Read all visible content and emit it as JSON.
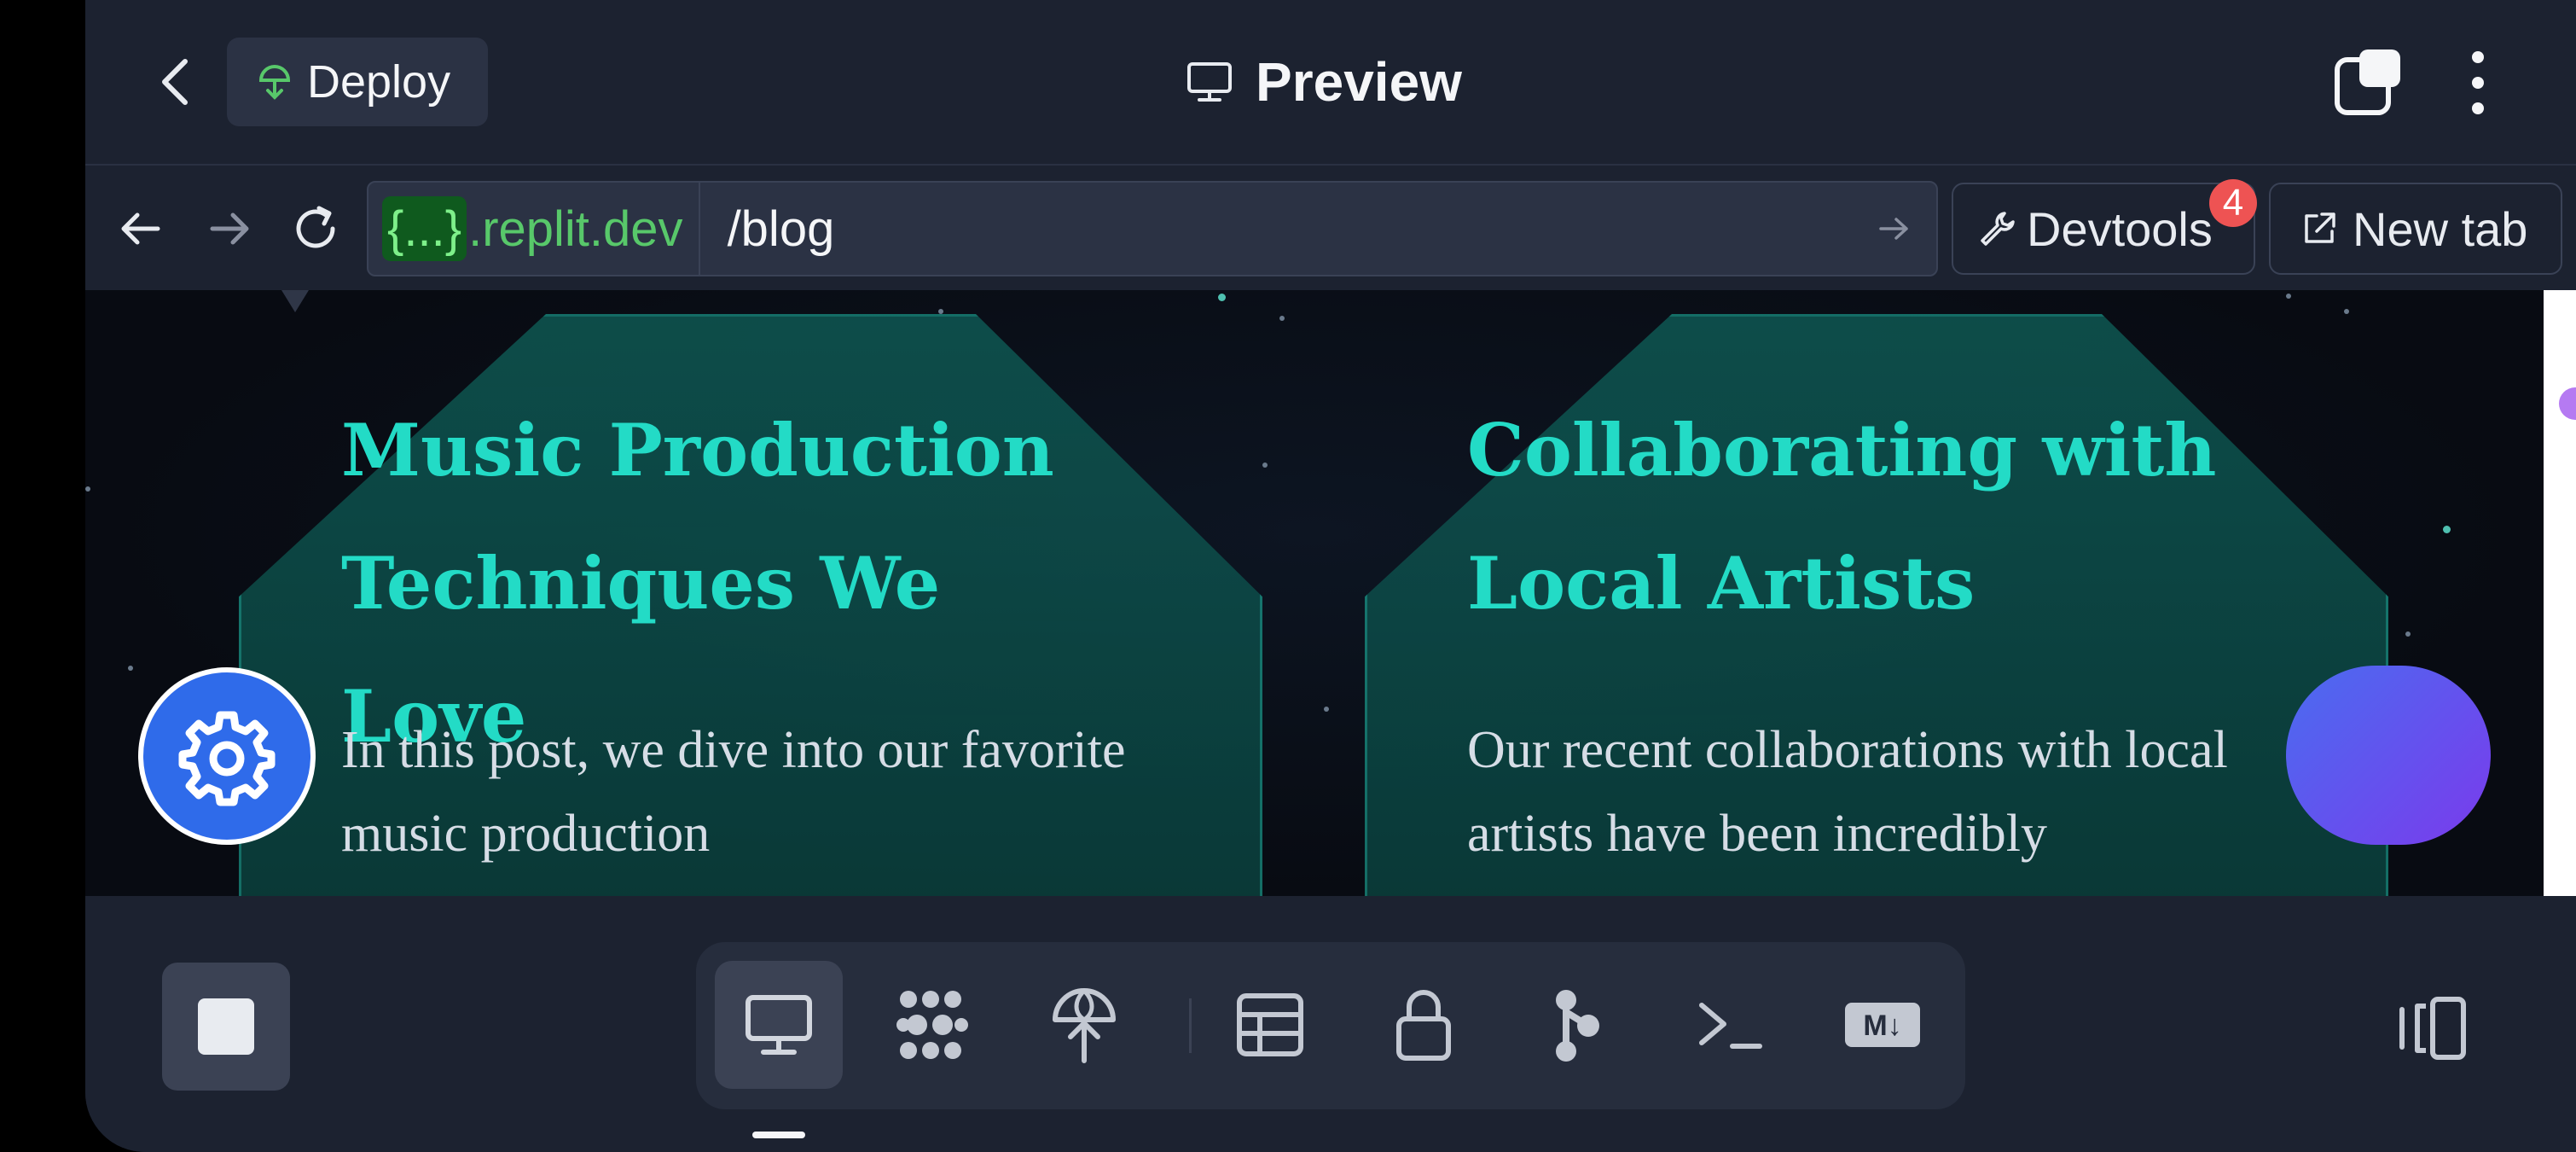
{
  "header": {
    "deploy_label": "Deploy",
    "title": "Preview"
  },
  "urlbar": {
    "host_chip": "{...}",
    "host_domain": ".replit.dev",
    "path": "/blog",
    "devtools_label": "Devtools",
    "devtools_badge": "4",
    "newtab_label": "New tab"
  },
  "page": {
    "cards": [
      {
        "title": "Music Production Techniques We Love",
        "excerpt": "In this post, we dive into our favorite music production"
      },
      {
        "title": "Collaborating with Local Artists",
        "excerpt": "Our recent collaborations with local artists have been incredibly"
      }
    ]
  },
  "toolbar": {
    "tools": [
      "preview",
      "packages",
      "deploy",
      "database",
      "secrets",
      "git",
      "shell",
      "markdown"
    ],
    "markdown_label": "M↓"
  },
  "colors": {
    "accent_teal": "#23dbc6",
    "fab_blue": "#2f6bea",
    "chat_gradient_start": "#4a6cf0",
    "chat_gradient_end": "#7a3bec",
    "badge_red": "#ee5353",
    "host_green": "#58c86a"
  }
}
